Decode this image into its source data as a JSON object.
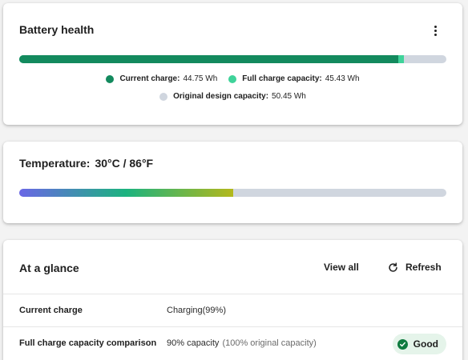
{
  "battery_health": {
    "title": "Battery health",
    "more_icon": "more-vertical-icon",
    "bar": {
      "current_charge_wh": 44.75,
      "full_charge_capacity_wh": 45.43,
      "design_capacity_wh": 50.45
    },
    "legend": [
      {
        "label": "Current charge:",
        "value": "44.75 Wh",
        "color": "#138a5e"
      },
      {
        "label": "Full charge capacity:",
        "value": "45.43 Wh",
        "color": "#3fd39a"
      },
      {
        "label": "Original design capacity:",
        "value": "50.45 Wh",
        "color": "#d0d6df"
      }
    ]
  },
  "temperature": {
    "label": "Temperature:",
    "value": "30°C / 86°F",
    "level_percent": 50,
    "gradient": [
      "#6a67e6",
      "#1cb37f",
      "#b3b81c"
    ],
    "track_color": "#d0d6df"
  },
  "at_a_glance": {
    "title": "At a glance",
    "view_all_label": "View all",
    "refresh_label": "Refresh",
    "refresh_icon": "refresh-icon",
    "rows": [
      {
        "label": "Current charge",
        "value": "Charging(99%)",
        "muted": ""
      },
      {
        "label": "Full charge capacity comparison",
        "value": "90% capacity",
        "muted": "(100% original capacity)",
        "status": "Good",
        "status_icon": "check-circle-icon",
        "status_color": "#0f7b3f"
      }
    ]
  }
}
